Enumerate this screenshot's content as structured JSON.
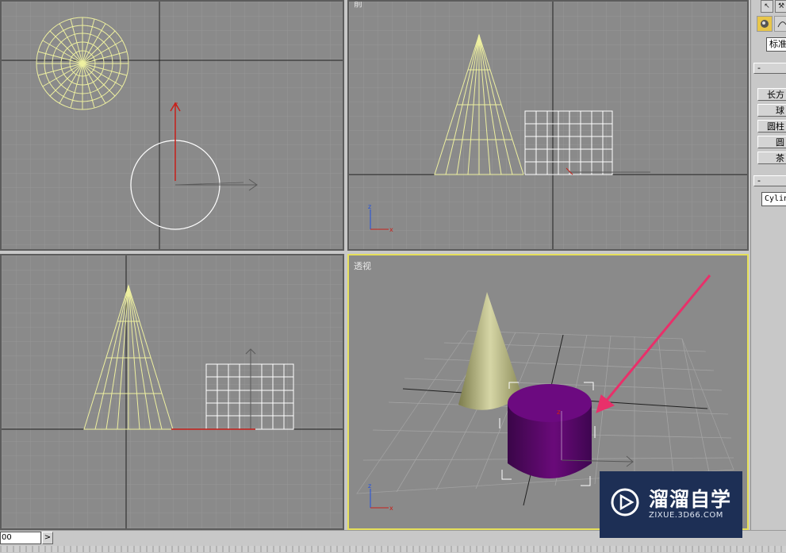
{
  "viewports": {
    "top_label": "",
    "front_label": "前",
    "left_label": "",
    "perspective_label": "透视"
  },
  "axes": {
    "x": "x",
    "y": "y",
    "z": "z"
  },
  "command_panel": {
    "dropdown_value": "标准",
    "rollout_object_type": "-",
    "buttons": [
      "长方",
      "球",
      "圆柱",
      "圆",
      "茶"
    ],
    "rollout_name_color": "-",
    "name_field_value": "Cylin"
  },
  "status_bar": {
    "frame_value": "00",
    "next_button": ">"
  },
  "watermark": {
    "title": "溜溜自学",
    "url": "ZIXUE.3D66.COM"
  },
  "colors": {
    "viewport_bg": "#8a8a8a",
    "wireframe_cone": "#eef0a0",
    "wireframe_cylinder": "#ffffff",
    "active_border": "#e6e05a",
    "cylinder_fill": "#6a0a7a",
    "arrow": "#e8306a"
  },
  "icons": [
    "select-arrow-icon",
    "hammer-icon",
    "geometry-sphere-icon",
    "shapes-icon",
    "play-circle-icon"
  ]
}
